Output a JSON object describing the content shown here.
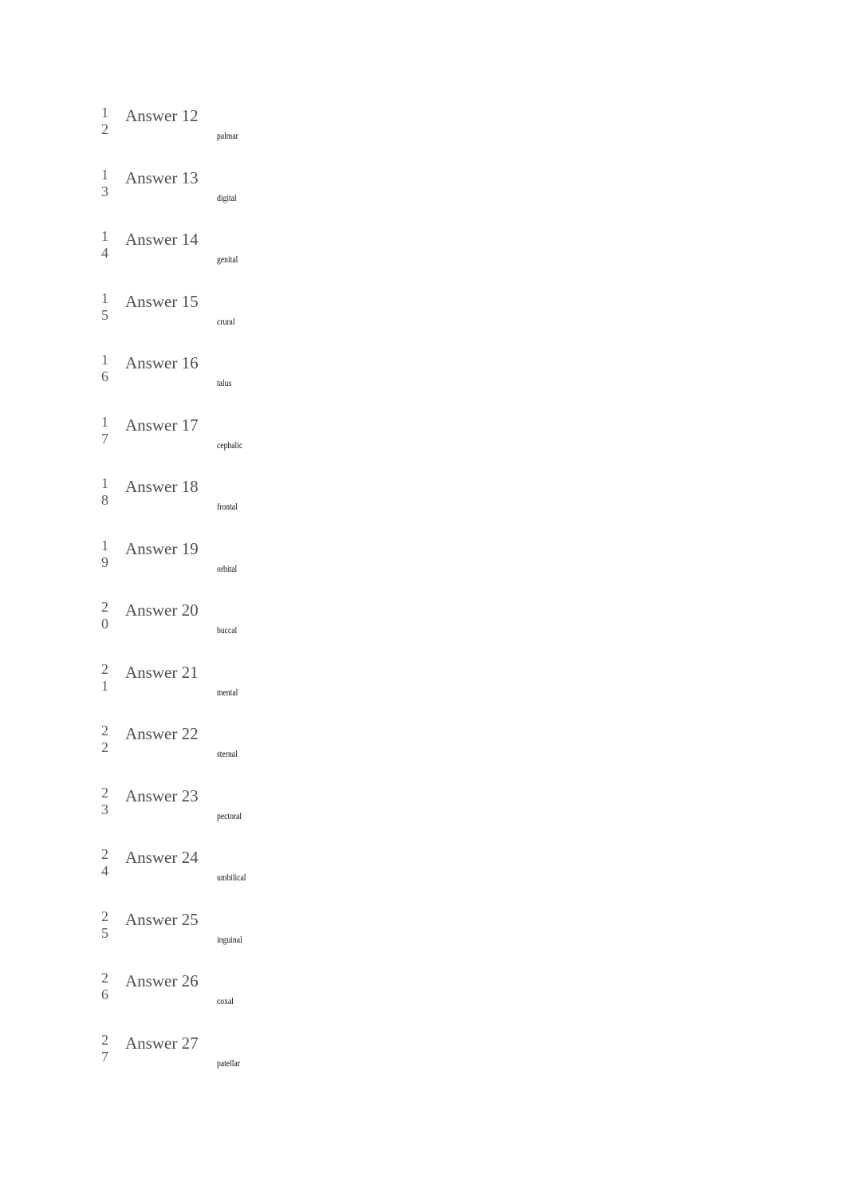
{
  "page": {
    "background_color": "#ffffff",
    "number_color": "#595959",
    "answer_color": "#4d4d4d",
    "term_color": "#0b0b0b"
  },
  "answer_list": {
    "rows": [
      {
        "number": "12",
        "answer_label": "Answer 12",
        "term": "palmar"
      },
      {
        "number": "13",
        "answer_label": "Answer 13",
        "term": "digital"
      },
      {
        "number": "14",
        "answer_label": "Answer 14",
        "term": "genital"
      },
      {
        "number": "15",
        "answer_label": "Answer 15",
        "term": "crural"
      },
      {
        "number": "16",
        "answer_label": "Answer 16",
        "term": "talus"
      },
      {
        "number": "17",
        "answer_label": "Answer 17",
        "term": "cephalic"
      },
      {
        "number": "18",
        "answer_label": "Answer 18",
        "term": "frontal"
      },
      {
        "number": "19",
        "answer_label": "Answer 19",
        "term": "orbital"
      },
      {
        "number": "20",
        "answer_label": "Answer 20",
        "term": "buccal"
      },
      {
        "number": "21",
        "answer_label": "Answer 21",
        "term": "mental"
      },
      {
        "number": "22",
        "answer_label": "Answer 22",
        "term": "sternal"
      },
      {
        "number": "23",
        "answer_label": "Answer 23",
        "term": "pectoral"
      },
      {
        "number": "24",
        "answer_label": "Answer 24",
        "term": "umbilical"
      },
      {
        "number": "25",
        "answer_label": "Answer 25",
        "term": "inguinal"
      },
      {
        "number": "26",
        "answer_label": "Answer 26",
        "term": "coxal"
      },
      {
        "number": "27",
        "answer_label": "Answer 27",
        "term": "patellar"
      }
    ]
  }
}
